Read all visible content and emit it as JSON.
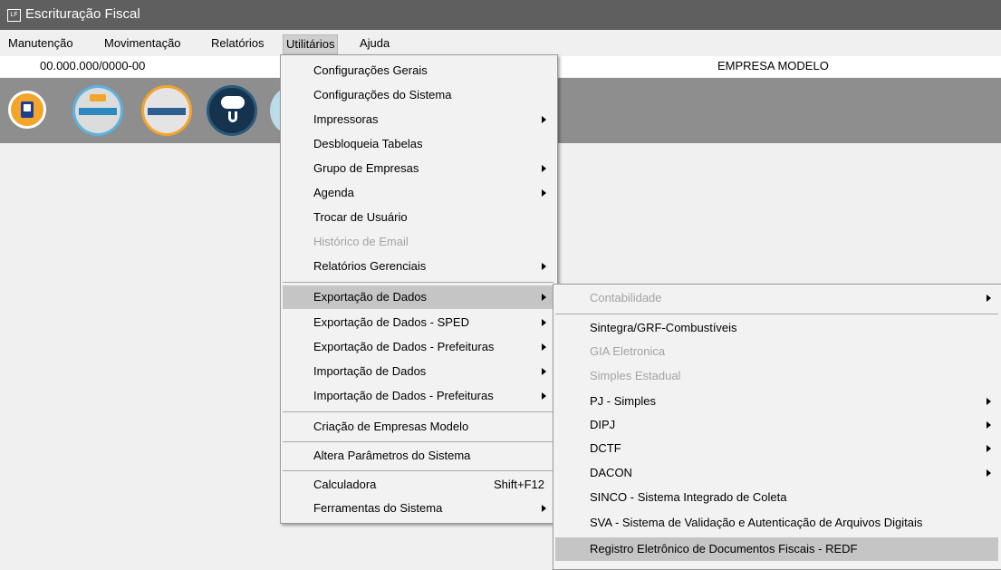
{
  "window": {
    "icon_text": "LF",
    "title": "Escrituração Fiscal"
  },
  "menubar": {
    "items": [
      "Manutenção",
      "Movimentação",
      "Relatórios",
      "Utilitários",
      "Ajuda"
    ]
  },
  "info": {
    "cnpj": "00.000.000/0000-00",
    "empresa": "EMPRESA MODELO"
  },
  "toolbar": {
    "icons": [
      "empresas-icon",
      "sped-contribuicoes-icon",
      "icms-ipi-icon",
      "cloud-download-icon",
      "partial-icon"
    ]
  },
  "utilitarios_menu": {
    "items": [
      {
        "label": "Configurações Gerais"
      },
      {
        "label": "Configurações do Sistema"
      },
      {
        "label": "Impressoras",
        "submenu": true
      },
      {
        "label": "Desbloqueia Tabelas"
      },
      {
        "label": "Grupo de Empresas",
        "submenu": true
      },
      {
        "label": "Agenda",
        "submenu": true
      },
      {
        "label": "Trocar de Usuário"
      },
      {
        "label": "Histórico de Email",
        "disabled": true
      },
      {
        "label": "Relatórios Gerenciais",
        "submenu": true
      },
      {
        "label": "Exportação de Dados",
        "submenu": true,
        "highlighted": true
      },
      {
        "label": "Exportação de Dados - SPED",
        "submenu": true
      },
      {
        "label": "Exportação de Dados - Prefeituras",
        "submenu": true
      },
      {
        "label": "Importação de Dados",
        "submenu": true
      },
      {
        "label": "Importação de Dados - Prefeituras",
        "submenu": true
      },
      {
        "label": "Criação de Empresas Modelo"
      },
      {
        "label": "Altera Parâmetros do Sistema"
      },
      {
        "label": "Calculadora",
        "shortcut": "Shift+F12"
      },
      {
        "label": "Ferramentas do Sistema",
        "submenu": true
      }
    ]
  },
  "exportacao_submenu": {
    "items": [
      {
        "label": "Contabilidade",
        "submenu": true,
        "disabled": true
      },
      {
        "label": "Sintegra/GRF-Combustíveis"
      },
      {
        "label": "GIA Eletronica",
        "disabled": true
      },
      {
        "label": "Simples Estadual",
        "disabled": true
      },
      {
        "label": "PJ - Simples",
        "submenu": true
      },
      {
        "label": "DIPJ",
        "submenu": true
      },
      {
        "label": "DCTF",
        "submenu": true
      },
      {
        "label": "DACON",
        "submenu": true
      },
      {
        "label": "SINCO - Sistema Integrado de Coleta"
      },
      {
        "label": "SVA - Sistema de Validação e Autenticação de Arquivos Digitais"
      },
      {
        "label": "Registro Eletrônico de Documentos Fiscais - REDF",
        "highlighted": true
      }
    ]
  }
}
